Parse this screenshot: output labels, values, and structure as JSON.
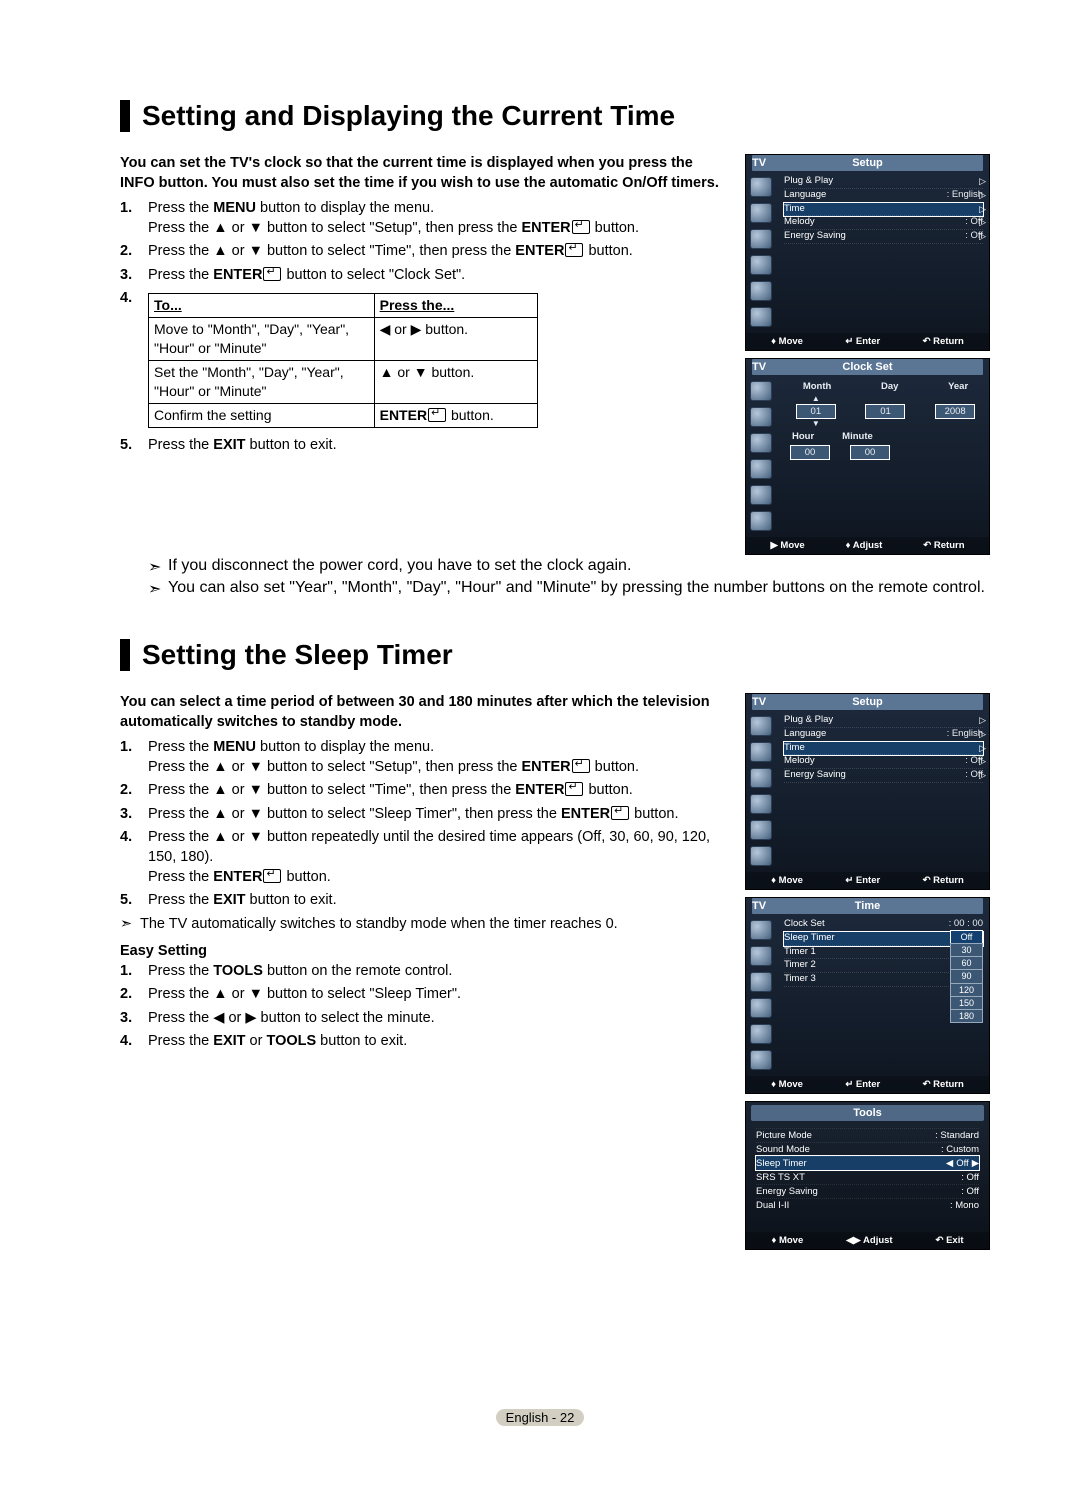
{
  "footer_label": "English - 22",
  "section1": {
    "title": "Setting and Displaying the Current Time",
    "intro": "You can set the TV's clock so that the current time is displayed when you press the INFO button. You must also set the time if you wish to use the automatic On/Off timers.",
    "step1_pre": "Press the ",
    "menu": "MENU",
    "step1_mid": " button to display the menu.\nPress the ▲ or ▼ button to select \"Setup\", then press the ",
    "enter": "ENTER",
    "step1_post": " button.",
    "step2_pre": "Press the ▲ or ▼ button to select \"Time\", then press the ",
    "step2_post": " button.",
    "step3_pre": "Press the ",
    "step3_post": " button to select \"Clock Set\".",
    "table": {
      "head_to": "To...",
      "head_press": "Press the...",
      "r1c1": "Move to \"Month\", \"Day\", \"Year\", \"Hour\" or \"Minute\"",
      "r1c2": "◀ or ▶ button.",
      "r2c1": "Set the \"Month\", \"Day\", \"Year\", \"Hour\" or \"Minute\"",
      "r2c2": "▲ or ▼ button.",
      "r3c1": "Confirm the setting",
      "r3c2_pre": "ENTER",
      "r3c2_post": " button."
    },
    "step5_pre": "Press the ",
    "exit": "EXIT",
    "step5_post": " button to exit.",
    "note1": "If you disconnect the power cord, you have to set the clock again.",
    "note2": "You can also set \"Year\", \"Month\", \"Day\", \"Hour\" and \"Minute\" by pressing the number buttons on the remote control."
  },
  "section2": {
    "title": "Setting the Sleep Timer",
    "intro": "You can select a time period of between 30 and 180 minutes after which the television automatically switches to standby mode.",
    "step1_pre": "Press the ",
    "step1_mid": " button to display the menu.\nPress the ▲ or ▼ button to select \"Setup\", then press the ",
    "step1_post": " button.",
    "step2_pre": "Press the ▲ or ▼ button to select \"Time\", then press the ",
    "step2_post": " button.",
    "step3_pre": "Press the ▲ or ▼ button to select \"Sleep Timer\", then press the ",
    "step3_post": " button.",
    "step4_pre": "Press the ▲ or ▼ button repeatedly until the desired time appears (Off, 30, 60, 90, 120, 150, 180).\nPress the ",
    "step4_post": " button.",
    "step5_pre": "Press the ",
    "step5_post": " button to exit.",
    "note1": "The TV automatically switches to standby mode when the timer reaches 0.",
    "easy_title": "Easy Setting",
    "e1_pre": "Press the ",
    "tools": "TOOLS",
    "e1_post": " button on the remote control.",
    "e2": "Press the ▲ or ▼ button to select \"Sleep Timer\".",
    "e3": "Press the ◀ or ▶ button to select the minute.",
    "e4_pre": "Press the ",
    "e4_mid": " or ",
    "e4_post": " button to exit."
  },
  "osd": {
    "tv": "TV",
    "setup": "Setup",
    "clockset": "Clock Set",
    "time": "Time",
    "toolsmenu": "Tools",
    "menu_items": {
      "plug": "Plug & Play",
      "language": "Language",
      "language_val": ": English",
      "time_item": "Time",
      "melody": "Melody",
      "melody_val": ": Off",
      "energy": "Energy Saving",
      "energy_val": ": Off"
    },
    "footer": {
      "move": "Move",
      "enter": "Enter",
      "return": "Return",
      "adjust": "Adjust",
      "exit": "Exit",
      "move_icon": "◆",
      "move_ud": "♦",
      "right": "▶",
      "ret": "↶"
    },
    "clock": {
      "month": "Month",
      "day": "Day",
      "year": "Year",
      "hour": "Hour",
      "minute": "Minute",
      "month_v": "01",
      "day_v": "01",
      "year_v": "2008",
      "hour_v": "00",
      "minute_v": "00"
    },
    "time_menu": {
      "clockset": "Clock Set",
      "clockset_v": ": 00 : 00",
      "sleep": "Sleep Timer",
      "t1": "Timer 1",
      "t2": "Timer 2",
      "t3": "Timer 3",
      "off_v": ": Off",
      "drop": [
        "Off",
        "30",
        "60",
        "90",
        "120",
        "150",
        "180"
      ]
    },
    "tools_items": {
      "pic": "Picture Mode",
      "pic_v": ": Standard",
      "snd": "Sound Mode",
      "snd_v": ": Custom",
      "slp": "Sleep Timer",
      "slp_v": "Off",
      "srs": "SRS TS XT",
      "srs_v": ": Off",
      "eng": "Energy Saving",
      "eng_v": ": Off",
      "dual": "Dual I-II",
      "dual_v": ": Mono"
    }
  }
}
